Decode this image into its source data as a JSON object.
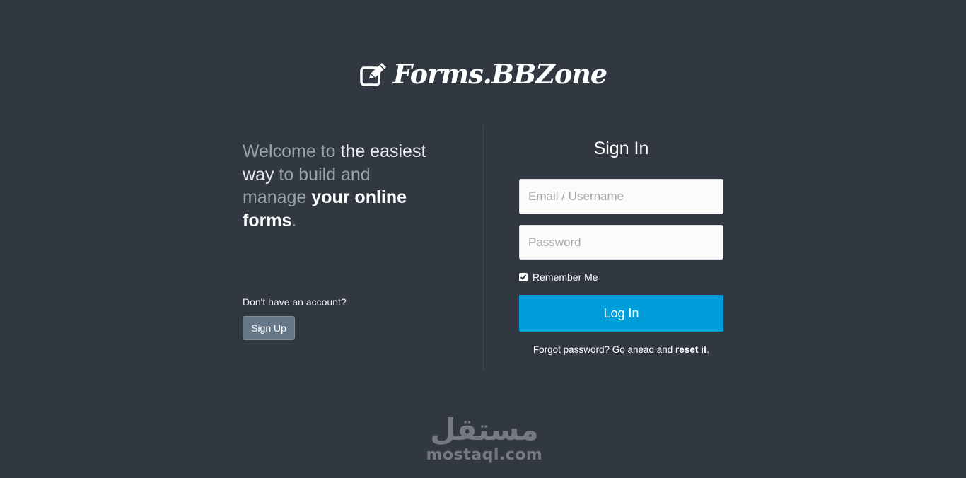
{
  "brand": {
    "name": "Forms.BBZone",
    "icon": "edit-square-icon"
  },
  "intro": {
    "part1": "Welcome to ",
    "part2": "the easiest",
    "part3": "way",
    "part4": " to build and",
    "part5": "manage ",
    "part6": "your online",
    "part7": "forms",
    "part8": "."
  },
  "signup": {
    "prompt": "Don't have an account?",
    "button_label": "Sign Up"
  },
  "signin": {
    "title": "Sign In",
    "email_placeholder": "Email / Username",
    "email_value": "",
    "password_placeholder": "Password",
    "password_value": "",
    "remember_label": "Remember Me",
    "remember_checked": true,
    "login_label": "Log In",
    "forgot_text": "Forgot password? Go ahead and ",
    "reset_link": "reset it",
    "forgot_end": "."
  },
  "watermark": {
    "arabic": "مستقل",
    "latin": "mostaql.com"
  },
  "colors": {
    "background": "#313842",
    "login_button": "#009ddb",
    "signup_button": "#677888"
  }
}
